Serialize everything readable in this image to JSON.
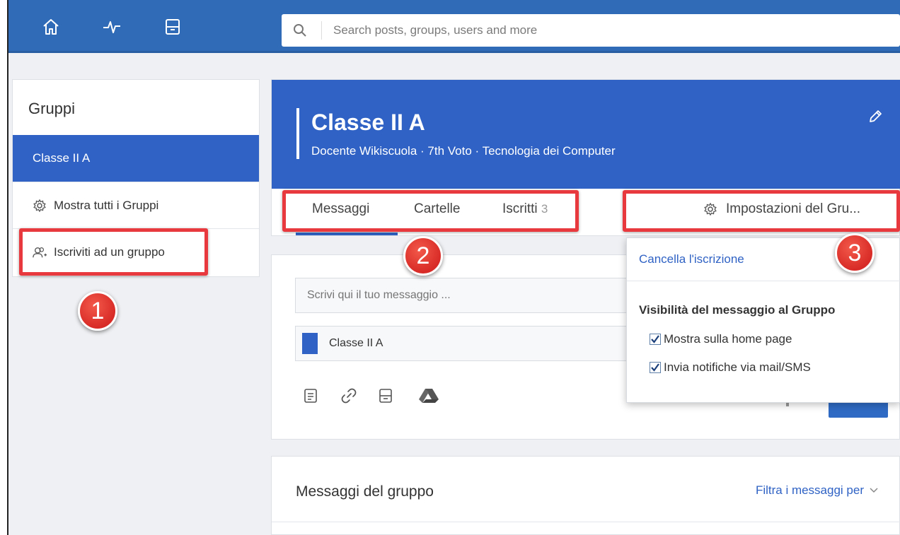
{
  "nav": {
    "icons": [
      "home-icon",
      "activity-icon",
      "planner-icon"
    ]
  },
  "search": {
    "placeholder": "Search posts, groups, users and more"
  },
  "sidebar": {
    "title": "Gruppi",
    "items": [
      {
        "label": "Classe II A",
        "active": true
      },
      {
        "label": "Mostra tutti i Gruppi",
        "icon": "gear-icon"
      },
      {
        "label": "Iscriviti ad un gruppo",
        "icon": "join-group-icon"
      }
    ]
  },
  "group": {
    "name": "Classe II A",
    "meta": "Docente Wikiscuola · 7th Voto · Tecnologia dei Computer",
    "tabs": [
      {
        "label": "Messaggi"
      },
      {
        "label": "Cartelle"
      },
      {
        "label": "Iscritti",
        "count": "3"
      }
    ],
    "settings_label": "Impostazioni del Gru..."
  },
  "composer": {
    "placeholder": "Scrivi qui il tuo messaggio ...",
    "selected_group": "Classe II A",
    "attachments": [
      "note-icon",
      "link-icon",
      "planner-icon",
      "drive-icon"
    ]
  },
  "dropdown": {
    "unsubscribe": "Cancella l'iscrizione",
    "visibility_title": "Visibilità del messaggio al Gruppo",
    "options": [
      {
        "label": "Mostra sulla home page",
        "checked": true
      },
      {
        "label": "Invia notifiche via mail/SMS",
        "checked": true
      }
    ]
  },
  "feed": {
    "title": "Messaggi del gruppo",
    "filter_label": "Filtra i messaggi per"
  },
  "callouts": [
    "1",
    "2",
    "3"
  ],
  "colors": {
    "brand_blue": "#2f62c4",
    "nav_blue": "#2f6bb7",
    "highlight_red": "#e8393f"
  }
}
